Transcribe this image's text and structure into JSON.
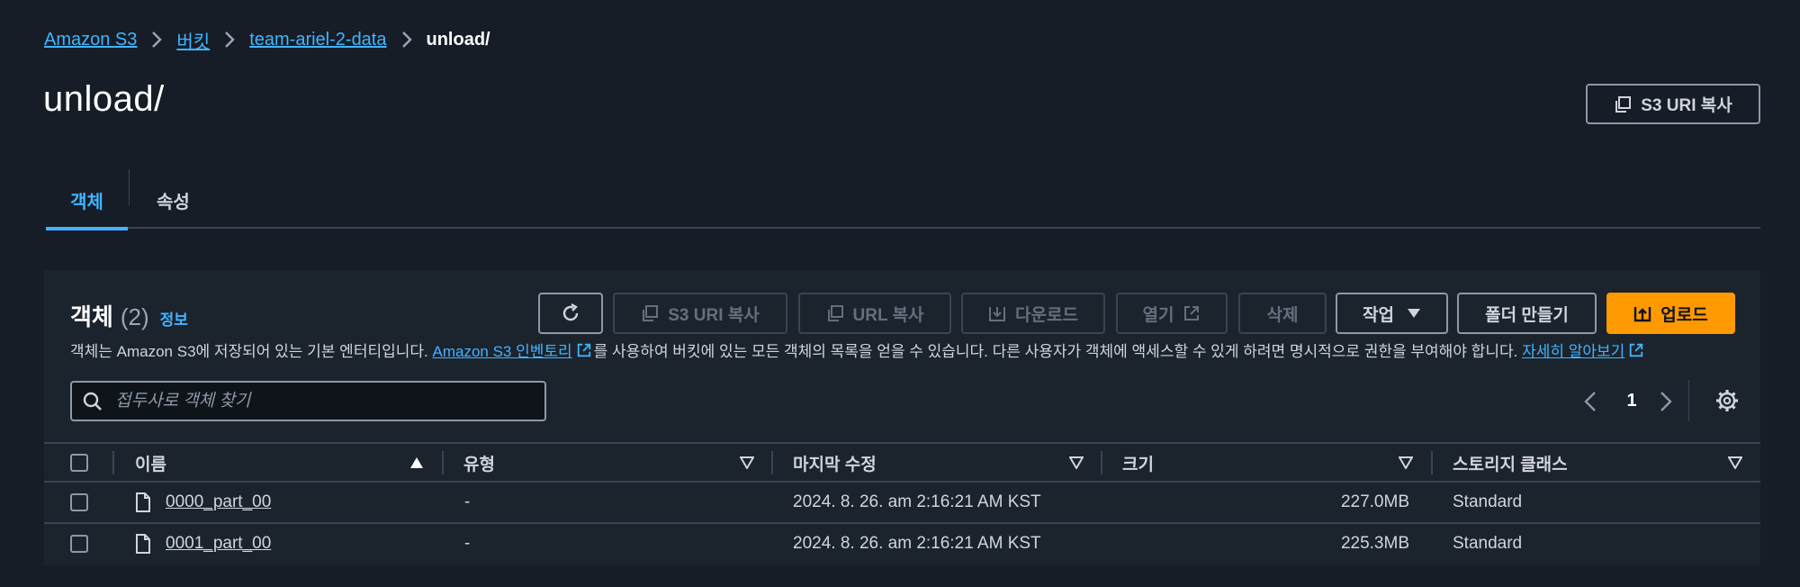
{
  "breadcrumb": {
    "items": [
      "Amazon S3",
      "버킷",
      "team-ariel-2-data"
    ],
    "current": "unload/"
  },
  "page": {
    "title": "unload/",
    "copy_uri_label": "S3 URI 복사"
  },
  "tabs": [
    {
      "label": "객체",
      "active": true
    },
    {
      "label": "속성",
      "active": false
    }
  ],
  "objects_panel": {
    "title": "객체",
    "count": "(2)",
    "info_label": "정보",
    "toolbar": {
      "copy_s3_uri": "S3 URI 복사",
      "copy_url": "URL 복사",
      "download": "다운로드",
      "open": "열기",
      "delete": "삭제",
      "actions": "작업",
      "create_folder": "폴더 만들기",
      "upload": "업로드"
    },
    "description": {
      "part1": "객체는 Amazon S3에 저장되어 있는 기본 엔터티입니다.",
      "inventory_link": "Amazon S3 인벤토리",
      "part2": "를 사용하여 버킷에 있는 모든 객체의 목록을 얻을 수 있습니다. 다른 사용자가 객체에 액세스할 수 있게 하려면 명시적으로 권한을 부여해야 합니다.",
      "learn_more": "자세히 알아보기"
    },
    "search": {
      "placeholder": "접두사로 객체 찾기",
      "value": ""
    },
    "pagination": {
      "current_page": "1"
    },
    "columns": {
      "name": "이름",
      "type": "유형",
      "last_modified": "마지막 수정",
      "size": "크기",
      "storage_class": "스토리지 클래스"
    },
    "rows": [
      {
        "name": "0000_part_00",
        "type": "-",
        "last_modified": "2024. 8. 26. am 2:16:21 AM KST",
        "size": "227.0MB",
        "storage_class": "Standard"
      },
      {
        "name": "0001_part_00",
        "type": "-",
        "last_modified": "2024. 8. 26. am 2:16:21 AM KST",
        "size": "225.3MB",
        "storage_class": "Standard"
      }
    ]
  },
  "colors": {
    "background": "#161d26",
    "panel": "#1b232d",
    "link": "#42b4ff",
    "primary": "#ff9900",
    "border": "#8d99a8"
  },
  "icons": [
    "chevron-right-icon",
    "copy-icon",
    "refresh-icon",
    "download-icon",
    "external-link-icon",
    "caret-down-icon",
    "upload-icon",
    "search-icon",
    "settings-icon",
    "file-icon",
    "sort-asc-icon",
    "sort-desc-icon"
  ]
}
